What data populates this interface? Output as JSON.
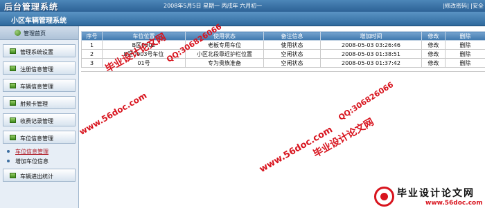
{
  "header": {
    "brand": "后台管理系统",
    "date_text": "2008年5月5日 星期一 丙戌年 六月初一",
    "links": [
      "|修改密码|",
      "|安全"
    ]
  },
  "system_title": "小区车辆管理系统",
  "sidebar": {
    "home_label": "管理首页",
    "items": [
      {
        "label": "管理系统设置"
      },
      {
        "label": "注册信息管理"
      },
      {
        "label": "车辆信息管理"
      },
      {
        "label": "射频卡管理"
      },
      {
        "label": "收费记录管理"
      },
      {
        "label": "车位信息管理"
      }
    ],
    "sub_items": [
      {
        "label": "车位信息管理",
        "active": true
      },
      {
        "label": "增加车位信息",
        "active": false
      }
    ],
    "last_item": {
      "label": "车辆进出统计"
    }
  },
  "table": {
    "headers": [
      "序号",
      "车位位置",
      "使用状态",
      "备注信息",
      "增加时间",
      "修改",
      "删除"
    ],
    "rows": [
      [
        "1",
        "B区0002",
        "老板专用车位",
        "使用状态",
        "2008-05-03 03:26:46",
        "修改",
        "删除"
      ],
      [
        "2",
        "B区0003号车位",
        "小区北段靠近护栏位置",
        "空闲状态",
        "2008-05-03 01:38:51",
        "修改",
        "删除"
      ],
      [
        "3",
        "01号",
        "专为贵族准备",
        "空闲状态",
        "2008-05-03 01:37:42",
        "修改",
        "删除"
      ]
    ]
  },
  "watermarks": {
    "site_cn": "毕业设计论文网",
    "qq": "QQ:306826066",
    "url": "www.56doc.com",
    "logo_title": "毕业设计论文网",
    "logo_url": "www.56doc.com"
  },
  "colors": {
    "header_blue": "#2d6296",
    "accent_red": "#d8141e",
    "nav_green": "#3e8a1b"
  }
}
